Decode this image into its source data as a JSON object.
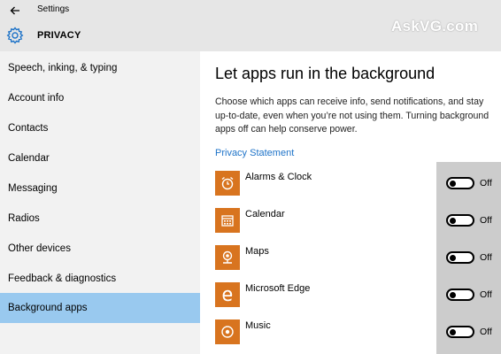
{
  "window": {
    "title": "Settings",
    "watermark": "AskVG.com"
  },
  "header": {
    "title": "PRIVACY",
    "icon": "gear-icon"
  },
  "sidebar": {
    "items": [
      {
        "label": "Speech, inking, & typing",
        "active": false
      },
      {
        "label": "Account info",
        "active": false
      },
      {
        "label": "Contacts",
        "active": false
      },
      {
        "label": "Calendar",
        "active": false
      },
      {
        "label": "Messaging",
        "active": false
      },
      {
        "label": "Radios",
        "active": false
      },
      {
        "label": "Other devices",
        "active": false
      },
      {
        "label": "Feedback & diagnostics",
        "active": false
      },
      {
        "label": "Background apps",
        "active": true
      }
    ]
  },
  "main": {
    "title": "Let apps run in the background",
    "description": "Choose which apps can receive info, send notifications, and stay up-to-date, even when you’re not using them. Turning background apps off can help conserve power.",
    "privacy_link": "Privacy Statement",
    "apps": [
      {
        "name": "Alarms & Clock",
        "icon": "alarm-clock-icon",
        "toggle": "Off"
      },
      {
        "name": "Calendar",
        "icon": "calendar-icon",
        "toggle": "Off"
      },
      {
        "name": "Maps",
        "icon": "maps-icon",
        "toggle": "Off"
      },
      {
        "name": "Microsoft Edge",
        "icon": "edge-icon",
        "toggle": "Off"
      },
      {
        "name": "Music",
        "icon": "music-icon",
        "toggle": "Off"
      }
    ]
  },
  "colors": {
    "accent": "#1e73c8",
    "active_item": "#99c9ef",
    "app_tile": "#d8741f",
    "highlight_column": "#cccccc"
  }
}
